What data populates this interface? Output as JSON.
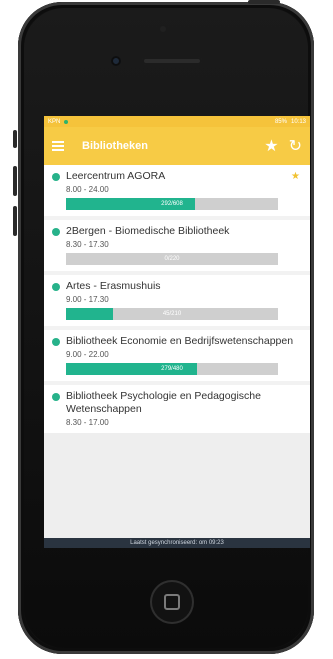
{
  "statusbar": {
    "time": "10:13",
    "network": "KPN",
    "battery": "85%"
  },
  "toolbar": {
    "title": "Bibliotheken",
    "menu_icon": "hamburger-icon",
    "favorite_icon": "star-icon",
    "refresh_icon": "refresh-icon"
  },
  "libraries": [
    {
      "name": "Leercentrum AGORA",
      "hours": "8.00 - 24.00",
      "occupancy": "292/608",
      "fill": 0.61,
      "favorite": true
    },
    {
      "name": "2Bergen - Biomedische Bibliotheek",
      "hours": "8.30 - 17.30",
      "occupancy": "0/220",
      "fill": 0.0,
      "favorite": false
    },
    {
      "name": "Artes - Erasmushuis",
      "hours": "9.00 - 17.30",
      "occupancy": "45/210",
      "fill": 0.22,
      "favorite": false
    },
    {
      "name": "Bibliotheek Economie en Bedrijfswetenschappen",
      "hours": "9.00 - 22.00",
      "occupancy": "279/480",
      "fill": 0.62,
      "favorite": false
    },
    {
      "name": "Bibliotheek Psychologie en Pedagogische Wetenschappen",
      "hours": "8.30 - 17.00",
      "occupancy": "",
      "fill": 0.0,
      "favorite": false
    }
  ],
  "footer": {
    "text": "Laatst gesynchroniseerd: om 09:23"
  },
  "colors": {
    "toolbar": "#f7cb45",
    "accent": "#21b48e",
    "bar_bg": "#cfcfcf",
    "footer": "#2a3440"
  }
}
